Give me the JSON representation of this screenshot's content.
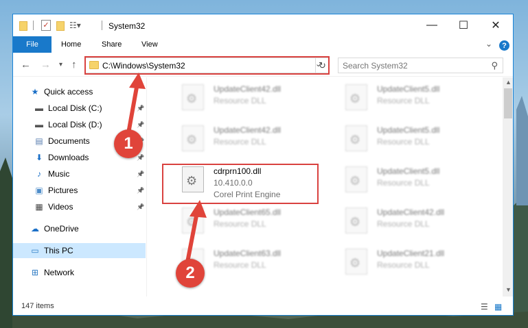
{
  "window": {
    "title": "System32",
    "minimize_glyph": "—",
    "maximize_glyph": "☐",
    "close_glyph": "✕"
  },
  "ribbon": {
    "file_label": "File",
    "tabs": [
      "Home",
      "Share",
      "View"
    ],
    "help_glyph": "?"
  },
  "address": {
    "path": "C:\\Windows\\System32",
    "search_placeholder": "Search System32"
  },
  "sidebar": {
    "items": [
      {
        "label": "Quick access",
        "icon": "star-icon",
        "glyph": "★",
        "color": "#1a6fc7",
        "pinned": false
      },
      {
        "label": "Local Disk (C:)",
        "icon": "drive-icon",
        "glyph": "▬",
        "color": "#555555",
        "pinned": true
      },
      {
        "label": "Local Disk (D:)",
        "icon": "drive-icon",
        "glyph": "▬",
        "color": "#555555",
        "pinned": true
      },
      {
        "label": "Documents",
        "icon": "documents-icon",
        "glyph": "▤",
        "color": "#5b7fb0",
        "pinned": true
      },
      {
        "label": "Downloads",
        "icon": "download-icon",
        "glyph": "⬇",
        "color": "#1a6fc7",
        "pinned": true
      },
      {
        "label": "Music",
        "icon": "music-icon",
        "glyph": "♪",
        "color": "#1a6fc7",
        "pinned": true
      },
      {
        "label": "Pictures",
        "icon": "pictures-icon",
        "glyph": "▣",
        "color": "#4d8cc9",
        "pinned": true
      },
      {
        "label": "Videos",
        "icon": "videos-icon",
        "glyph": "▦",
        "color": "#4a4a4a",
        "pinned": true
      },
      {
        "label": "OneDrive",
        "icon": "cloud-icon",
        "glyph": "☁",
        "color": "#1a6fc7",
        "pinned": false
      },
      {
        "label": "This PC",
        "icon": "computer-icon",
        "glyph": "▭",
        "color": "#2d7bc4",
        "pinned": false
      },
      {
        "label": "Network",
        "icon": "network-icon",
        "glyph": "⊞",
        "color": "#2d7bc4",
        "pinned": false
      }
    ]
  },
  "files": [
    {
      "name": "UpdateClient42.dll",
      "sub1": "Resource DLL",
      "sub2": "",
      "blurred": true
    },
    {
      "name": "UpdateClient5.dll",
      "sub1": "Resource DLL",
      "sub2": "",
      "blurred": true
    },
    {
      "name": "UpdateClient42.dll",
      "sub1": "Resource DLL",
      "sub2": "",
      "blurred": true
    },
    {
      "name": "UpdateClient5.dll",
      "sub1": "Resource DLL",
      "sub2": "",
      "blurred": true
    },
    {
      "name": "cdrprn100.dll",
      "sub1": "10.410.0.0",
      "sub2": "Corel Print Engine",
      "blurred": false
    },
    {
      "name": "UpdateClient5.dll",
      "sub1": "Resource DLL",
      "sub2": "",
      "blurred": true
    },
    {
      "name": "UpdateClient65.dll",
      "sub1": "Resource DLL",
      "sub2": "",
      "blurred": true
    },
    {
      "name": "UpdateClient42.dll",
      "sub1": "Resource DLL",
      "sub2": "",
      "blurred": true
    },
    {
      "name": "UpdateClient63.dll",
      "sub1": "Resource DLL",
      "sub2": "",
      "blurred": true
    },
    {
      "name": "UpdateClient21.dll",
      "sub1": "Resource DLL",
      "sub2": "",
      "blurred": true
    }
  ],
  "status": {
    "item_count": "147 items"
  },
  "annotations": {
    "step1": "1",
    "step2": "2",
    "highlight_color": "#d9413f"
  }
}
